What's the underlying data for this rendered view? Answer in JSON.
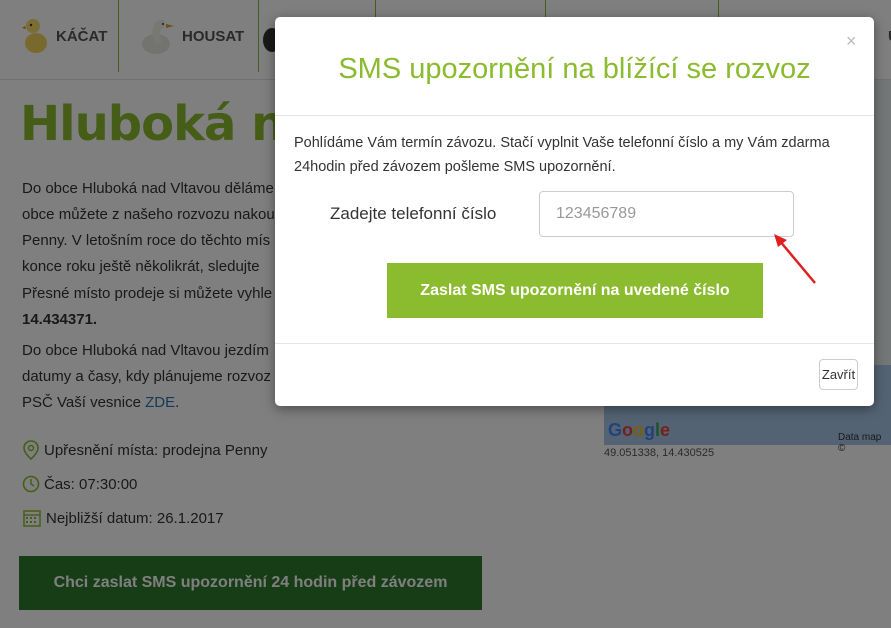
{
  "nav": {
    "items": [
      {
        "label": "KÁČAT"
      },
      {
        "label": "HOUSAT"
      },
      {
        "label": ""
      },
      {
        "label": ""
      },
      {
        "label": ""
      },
      {
        "label": "Ú"
      }
    ]
  },
  "page": {
    "title": "Hluboká nad",
    "para1_line1": "Do obce Hluboká nad Vltavou děláme",
    "para1_line2": "obce můžete z našeho rozvozu nakou",
    "para1_line3": "Penny. V letošním roce do těchto mís",
    "para1_line4": "konce roku ještě několikrát, sledujte",
    "para2_line1": "Přesné místo prodeje si můžete vyhle",
    "para2_line2": "14.434371.",
    "para3_line1": "Do obce Hluboká nad Vltavou jezdím",
    "para3_line2": "datumy a časy, kdy plánujeme rozvoz",
    "para3_line3_prefix": "PSČ Vaší vesnice ",
    "para3_link": "ZDE",
    "para3_suffix": ".",
    "place": "Upřesnění místa: prodejna Penny",
    "time": "Čas: 07:30:00",
    "date": "Nejbližší datum: 26.1.2017",
    "bottom_button": "Chci zaslat SMS upozornění 24 hodin před závozem"
  },
  "map": {
    "google": "Google",
    "data_label": "Data map ©",
    "coords": "49.051338, 14.430525"
  },
  "modal": {
    "title": "SMS upozornění na blížící se rozvoz",
    "close_symbol": "×",
    "text": "Pohlídáme Vám termín závozu. Stačí vyplnit Vaše telefonní číslo a my Vám zdarma 24hodin před závozem pošleme SMS upozornění.",
    "phone_label": "Zadejte telefonní číslo",
    "phone_placeholder": "123456789",
    "send_button": "Zaslat SMS upozornění na uvedené číslo",
    "close_button": "Zavřít"
  },
  "colors": {
    "brand_green": "#8bbb2e",
    "dark_green": "#2d7a2d",
    "link_blue": "#2a74b5",
    "arrow_red": "#e02020"
  }
}
